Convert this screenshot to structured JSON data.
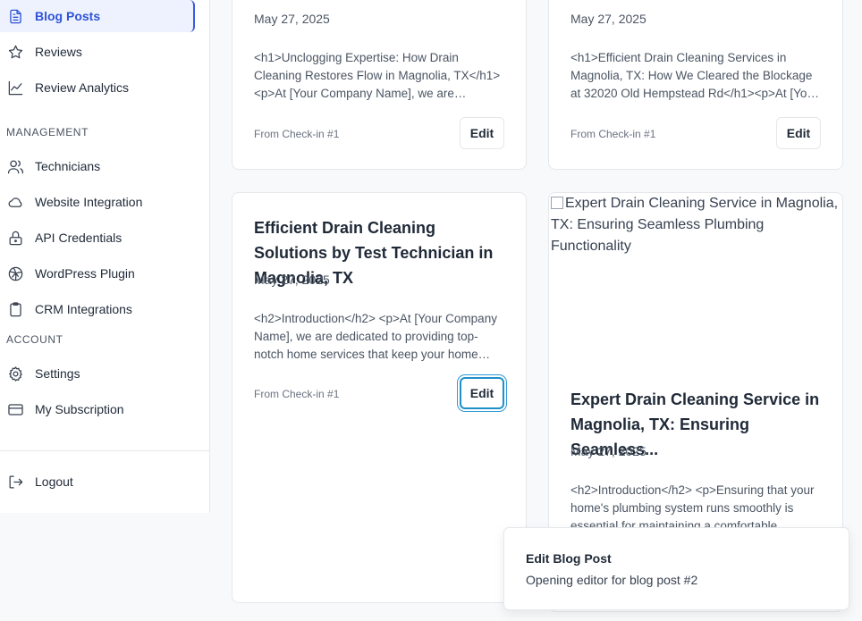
{
  "sidebar": {
    "items": [
      {
        "label": "Blog Posts",
        "icon": "document-icon",
        "active": true
      },
      {
        "label": "Reviews",
        "icon": "star-icon"
      },
      {
        "label": "Review Analytics",
        "icon": "line-chart-icon"
      }
    ],
    "management_label": "MANAGEMENT",
    "management_items": [
      {
        "label": "Technicians",
        "icon": "users-icon"
      },
      {
        "label": "Website Integration",
        "icon": "cloud-icon"
      },
      {
        "label": "API Credentials",
        "icon": "lock-icon"
      },
      {
        "label": "WordPress Plugin",
        "icon": "globe-icon"
      },
      {
        "label": "CRM Integrations",
        "icon": "clipboard-icon"
      }
    ],
    "account_label": "ACCOUNT",
    "account_items": [
      {
        "label": "Settings",
        "icon": "gear-icon"
      },
      {
        "label": "My Subscription",
        "icon": "credit-card-icon"
      }
    ],
    "logout_label": "Logout"
  },
  "posts": [
    {
      "date": "May 27, 2025",
      "excerpt": "<h1>Unclogging Expertise: How Drain Cleaning Restores Flow in Magnolia, TX</h1> <p>At [Your Company Name], we are dedicated to providing top-notch home services.",
      "source": "From Check-in #1",
      "edit_label": "Edit"
    },
    {
      "date": "May 27, 2025",
      "excerpt": "<h1>Efficient Drain Cleaning Services in Magnolia, TX: How We Cleared the Blockage at 32020 Old Hempstead Rd</h1><p>At [Your Company Name] we are dedicated.",
      "source": "From Check-in #1",
      "edit_label": "Edit"
    },
    {
      "title": "Efficient Drain Cleaning Solutions by Test Technician in Magnolia, TX",
      "date": "May 27, 2025",
      "excerpt": "<h2>Introduction</h2> <p>At [Your Company Name], we are dedicated to providing top-notch home services that keep your home running.",
      "source": "From Check-in #1",
      "edit_label": "Edit"
    },
    {
      "image_alt": "Expert Drain Cleaning Service in Magnolia, TX: Ensuring Seamless Plumbing Functionality",
      "title": "Expert Drain Cleaning Service in Magnolia, TX: Ensuring Seamless...",
      "date": "May 27, 2025",
      "excerpt": "<h2>Introduction</h2> <p>Ensuring that your home's plumbing system runs smoothly is essential for maintaining a comfortable"
    }
  ],
  "toast": {
    "title": "Edit Blog Post",
    "description": "Opening editor for blog post #2"
  },
  "colors": {
    "accent": "#2f54d6",
    "active_bg": "#eef2ff",
    "focus_ring": "#1e90c8"
  }
}
